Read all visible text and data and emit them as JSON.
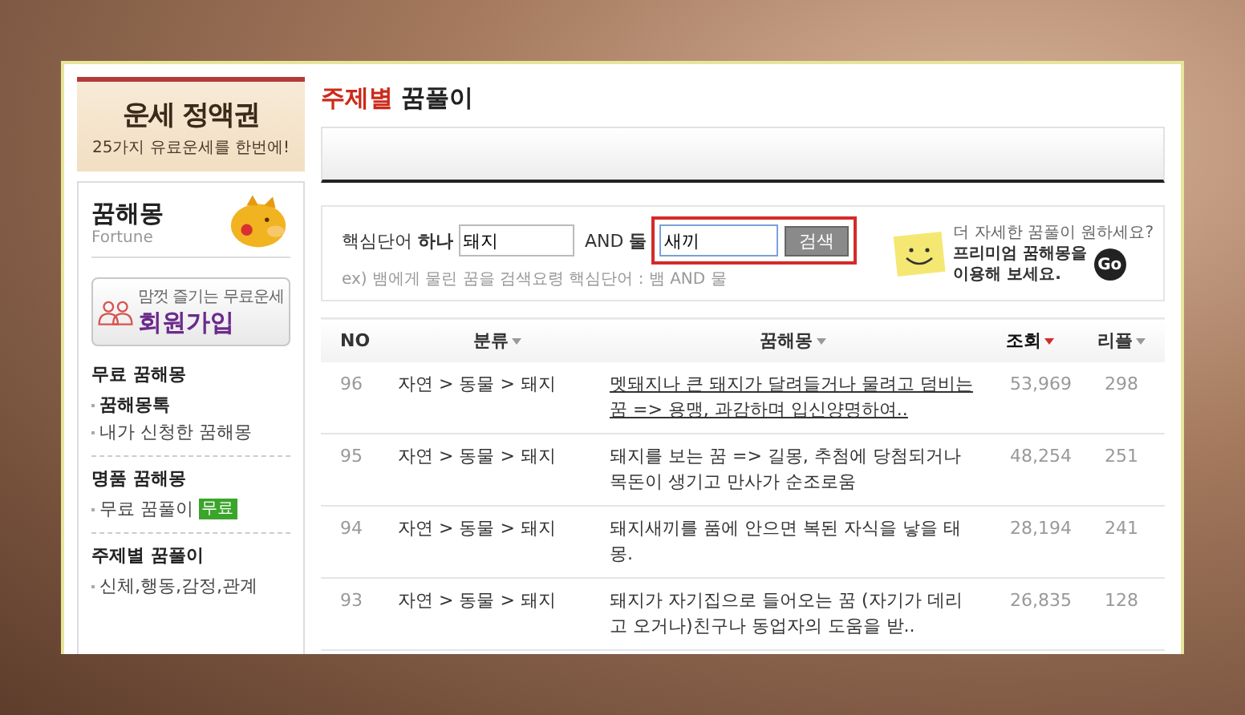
{
  "sidebar": {
    "banner": {
      "title": "운세 정액권",
      "subtitle": "25가지 유료운세를 한번에!"
    },
    "profile": {
      "title": "꿈해몽",
      "subtitle": "Fortune"
    },
    "join_button": {
      "caption": "맘껏 즐기는 무료운세",
      "label": "회원가입"
    },
    "sections": [
      {
        "title": "무료 꿈해몽",
        "items": [
          {
            "label": "꿈해몽톡",
            "bold": true
          },
          {
            "label": "내가 신청한 꿈해몽",
            "bold": false
          }
        ]
      },
      {
        "title": "명품 꿈해몽",
        "items": [
          {
            "label": "무료 꿈풀이",
            "bold": false,
            "badge": "무료"
          }
        ]
      },
      {
        "title": "주제별 꿈풀이",
        "items": [
          {
            "label": "신체,행동,감정,관계",
            "bold": false
          }
        ]
      }
    ]
  },
  "main": {
    "title": {
      "highlight": "주제별",
      "rest": "꿈풀이"
    },
    "search": {
      "label": "핵심단어",
      "first_label": "하나",
      "first_value": "돼지",
      "and_label": "AND",
      "second_label": "둘",
      "second_value": "새끼",
      "button": "검색",
      "highlighted": true,
      "hint": "ex) 뱀에게 물린 꿈을 검색요령 핵심단어 : 뱀 AND 물"
    },
    "promo": {
      "question": "더 자세한 꿈풀이 원하세요?",
      "line_1": "프리미엄 꿈해몽을",
      "line_2": "이용해 보세요.",
      "go": "Go"
    },
    "table": {
      "columns": [
        {
          "label": "NO",
          "sortable": false,
          "selected": false
        },
        {
          "label": "분류",
          "sortable": true,
          "selected": false
        },
        {
          "label": "꿈해몽",
          "sortable": true,
          "selected": false
        },
        {
          "label": "조회",
          "sortable": true,
          "selected": true
        },
        {
          "label": "리플",
          "sortable": true,
          "selected": false
        }
      ],
      "rows": [
        {
          "no": "96",
          "category": "자연 > 동물 > 돼지",
          "text": "멧돼지나 큰 돼지가 달려들거나 물려고 덤비는 꿈 => 용맹, 과감하며 입신양명하여..",
          "views": "53,969",
          "replies": "298",
          "hovered": true
        },
        {
          "no": "95",
          "category": "자연 > 동물 > 돼지",
          "text": "돼지를 보는 꿈 => 길몽, 추첨에 당첨되거나 목돈이 생기고 만사가 순조로움",
          "views": "48,254",
          "replies": "251",
          "hovered": false
        },
        {
          "no": "94",
          "category": "자연 > 동물 > 돼지",
          "text": "돼지새끼를 품에 안으면 복된 자식을 낳을 태몽.",
          "views": "28,194",
          "replies": "241",
          "hovered": false
        },
        {
          "no": "93",
          "category": "자연 > 동물 > 돼지",
          "text": "돼지가 자기집으로 들어오는 꿈 (자기가 데리고 오거나)친구나 동업자의 도움을 받..",
          "views": "26,835",
          "replies": "128",
          "hovered": false
        }
      ]
    }
  }
}
